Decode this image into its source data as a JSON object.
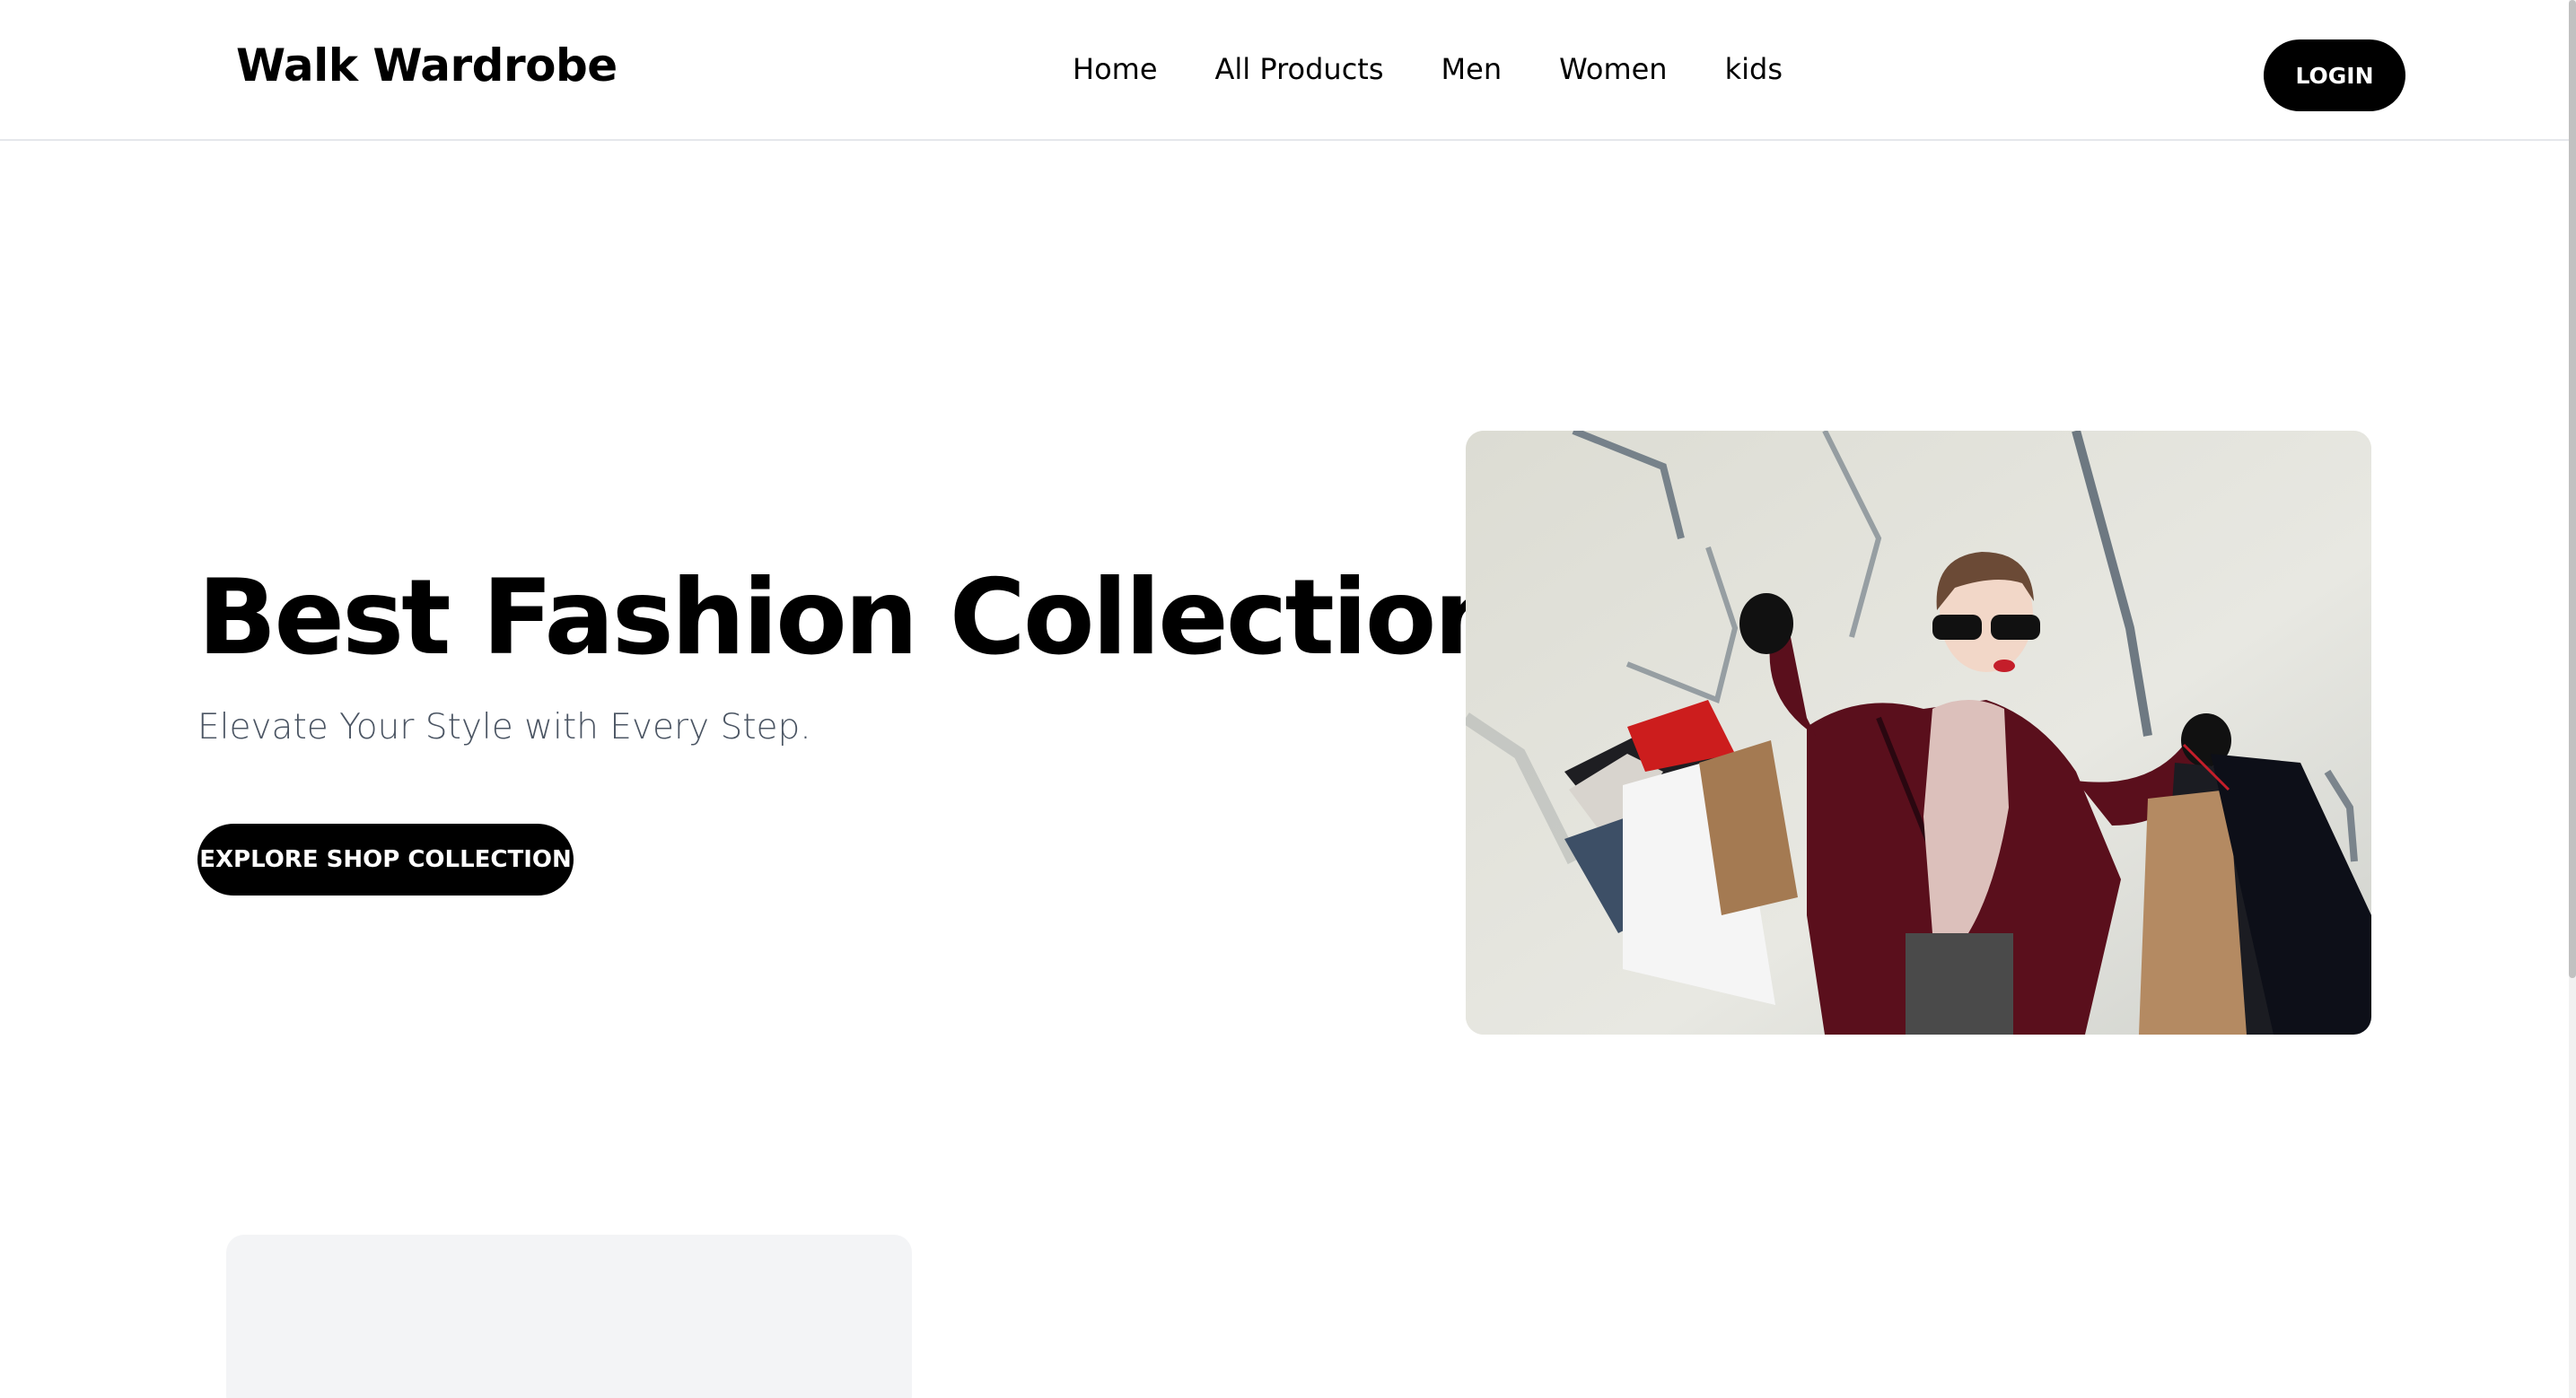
{
  "header": {
    "brand": "Walk Wardrobe",
    "nav": [
      "Home",
      "All Products",
      "Men",
      "Women",
      "kids"
    ],
    "login_label": "LOGIN"
  },
  "hero": {
    "title": "Best Fashion Collection",
    "subtitle": "Elevate Your Style with Every Step.",
    "cta_label": "EXPLORE SHOP COLLECTION",
    "image_icon": "hero-photo-woman-shopping-bags"
  },
  "colors": {
    "primary": "#000000",
    "background": "#ffffff",
    "subtitle": "#4b5563",
    "card_placeholder": "#f3f4f6",
    "coat": "#5a0f1c"
  }
}
